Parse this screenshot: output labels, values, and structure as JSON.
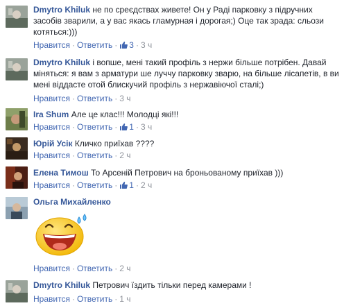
{
  "ui": {
    "like_label": "Нравится",
    "reply_label": "Ответить",
    "separator": "·"
  },
  "comments": [
    {
      "author": "Dmytro Khiluk",
      "text": "не по среєдствах живете! Он у Раді парковку з підручних засобів зварили, а у вас якась гламурная і дорогая;) Оце так зрада: сльози котяться:)))",
      "likes": "3",
      "time": "3 ч"
    },
    {
      "author": "Dmytro Khiluk",
      "text": "і вопше, мені такий профіль з нержи більше потрібен. Давай міняться: я вам з арматури ше луччу парковку зварю, на більше лісапетів, в ви мені віддасте отой блискучий профіль з нержавіючої сталі;)",
      "time": "3 ч"
    },
    {
      "author": "Ira Shum",
      "text": "Але це клас!!! Молодці які!!!",
      "likes": "1",
      "time": "3 ч"
    },
    {
      "author": "Юрій Усік",
      "text": "Кличко приїхав ????",
      "time": "2 ч"
    },
    {
      "author": "Елена Тимош",
      "text": "То Арсеній Петрович на броньованому приїхав )))",
      "likes": "1",
      "time": "2 ч"
    },
    {
      "author": "Ольга Михайленко",
      "text": "",
      "time": "2 ч"
    },
    {
      "author": "Dmytro Khiluk",
      "text": "Петрович їздить тільки перед камерами !",
      "time": "1 ч"
    }
  ],
  "colors": {
    "author": "#365899",
    "action": "#4267b2",
    "meta": "#90949c",
    "text": "#1d2129",
    "sticker": "#f7c92d"
  },
  "icons": {
    "like": "thumbs-up-icon",
    "sticker": "laughing-face-sticker"
  }
}
